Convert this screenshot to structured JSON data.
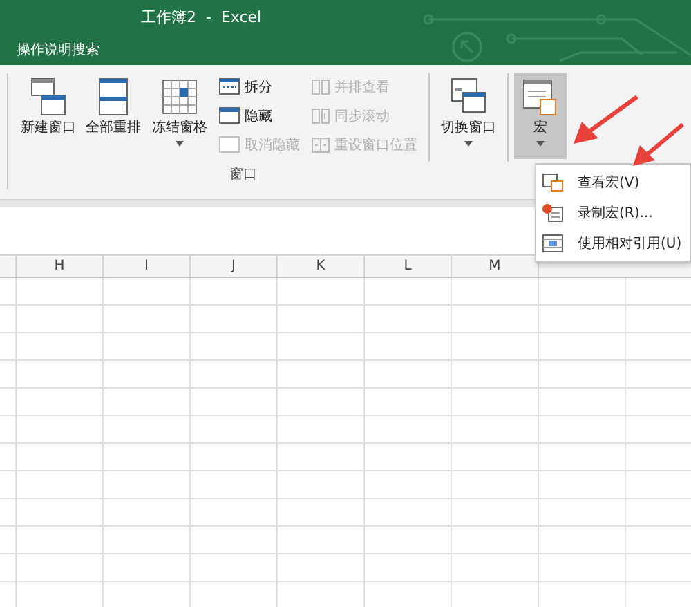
{
  "window": {
    "title": "工作簿2  -  Excel"
  },
  "tell_me": "操作说明搜索",
  "ribbon": {
    "window_group": {
      "label": "窗口",
      "big_buttons": [
        {
          "kind": "new",
          "label": "新建窗口",
          "dropdown": false
        },
        {
          "kind": "arrange",
          "label": "全部重排",
          "dropdown": false
        },
        {
          "kind": "freeze",
          "label": "冻结窗格",
          "dropdown": true
        }
      ],
      "small_buttons": [
        {
          "kind": "split",
          "label": "拆分",
          "disabled": false
        },
        {
          "kind": "hide",
          "label": "隐藏",
          "disabled": false
        },
        {
          "kind": "unhide",
          "label": "取消隐藏",
          "disabled": true
        }
      ],
      "side_buttons": [
        {
          "kind": "side",
          "label": "并排查看",
          "disabled": true
        },
        {
          "kind": "sync",
          "label": "同步滚动",
          "disabled": true
        },
        {
          "kind": "reset",
          "label": "重设窗口位置",
          "disabled": true
        }
      ],
      "switch": {
        "label": "切换窗口",
        "dropdown": true
      }
    },
    "macro": {
      "label": "宏",
      "pressed": true,
      "dropdown": true
    }
  },
  "macro_menu": [
    {
      "kind": "view",
      "label": "查看宏(V)"
    },
    {
      "kind": "record",
      "label": "录制宏(R)..."
    },
    {
      "kind": "relative",
      "label": "使用相对引用(U)"
    }
  ],
  "columns": [
    "H",
    "I",
    "J",
    "K",
    "L",
    "M"
  ]
}
